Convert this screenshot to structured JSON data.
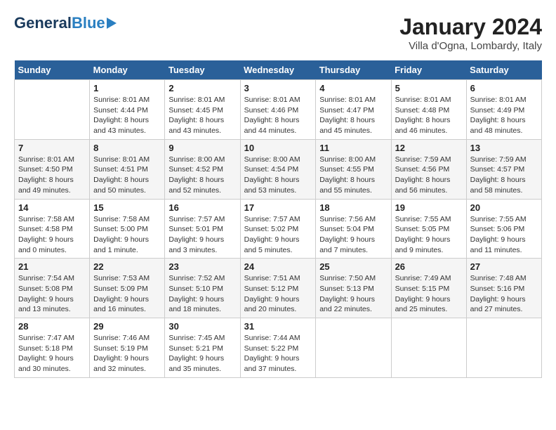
{
  "logo": {
    "general": "General",
    "blue": "Blue"
  },
  "title": "January 2024",
  "subtitle": "Villa d'Ogna, Lombardy, Italy",
  "weekdays": [
    "Sunday",
    "Monday",
    "Tuesday",
    "Wednesday",
    "Thursday",
    "Friday",
    "Saturday"
  ],
  "weeks": [
    [
      {
        "day": "",
        "sunrise": "",
        "sunset": "",
        "daylight": ""
      },
      {
        "day": "1",
        "sunrise": "Sunrise: 8:01 AM",
        "sunset": "Sunset: 4:44 PM",
        "daylight": "Daylight: 8 hours and 43 minutes."
      },
      {
        "day": "2",
        "sunrise": "Sunrise: 8:01 AM",
        "sunset": "Sunset: 4:45 PM",
        "daylight": "Daylight: 8 hours and 43 minutes."
      },
      {
        "day": "3",
        "sunrise": "Sunrise: 8:01 AM",
        "sunset": "Sunset: 4:46 PM",
        "daylight": "Daylight: 8 hours and 44 minutes."
      },
      {
        "day": "4",
        "sunrise": "Sunrise: 8:01 AM",
        "sunset": "Sunset: 4:47 PM",
        "daylight": "Daylight: 8 hours and 45 minutes."
      },
      {
        "day": "5",
        "sunrise": "Sunrise: 8:01 AM",
        "sunset": "Sunset: 4:48 PM",
        "daylight": "Daylight: 8 hours and 46 minutes."
      },
      {
        "day": "6",
        "sunrise": "Sunrise: 8:01 AM",
        "sunset": "Sunset: 4:49 PM",
        "daylight": "Daylight: 8 hours and 48 minutes."
      }
    ],
    [
      {
        "day": "7",
        "sunrise": "Sunrise: 8:01 AM",
        "sunset": "Sunset: 4:50 PM",
        "daylight": "Daylight: 8 hours and 49 minutes."
      },
      {
        "day": "8",
        "sunrise": "Sunrise: 8:01 AM",
        "sunset": "Sunset: 4:51 PM",
        "daylight": "Daylight: 8 hours and 50 minutes."
      },
      {
        "day": "9",
        "sunrise": "Sunrise: 8:00 AM",
        "sunset": "Sunset: 4:52 PM",
        "daylight": "Daylight: 8 hours and 52 minutes."
      },
      {
        "day": "10",
        "sunrise": "Sunrise: 8:00 AM",
        "sunset": "Sunset: 4:54 PM",
        "daylight": "Daylight: 8 hours and 53 minutes."
      },
      {
        "day": "11",
        "sunrise": "Sunrise: 8:00 AM",
        "sunset": "Sunset: 4:55 PM",
        "daylight": "Daylight: 8 hours and 55 minutes."
      },
      {
        "day": "12",
        "sunrise": "Sunrise: 7:59 AM",
        "sunset": "Sunset: 4:56 PM",
        "daylight": "Daylight: 8 hours and 56 minutes."
      },
      {
        "day": "13",
        "sunrise": "Sunrise: 7:59 AM",
        "sunset": "Sunset: 4:57 PM",
        "daylight": "Daylight: 8 hours and 58 minutes."
      }
    ],
    [
      {
        "day": "14",
        "sunrise": "Sunrise: 7:58 AM",
        "sunset": "Sunset: 4:58 PM",
        "daylight": "Daylight: 9 hours and 0 minutes."
      },
      {
        "day": "15",
        "sunrise": "Sunrise: 7:58 AM",
        "sunset": "Sunset: 5:00 PM",
        "daylight": "Daylight: 9 hours and 1 minute."
      },
      {
        "day": "16",
        "sunrise": "Sunrise: 7:57 AM",
        "sunset": "Sunset: 5:01 PM",
        "daylight": "Daylight: 9 hours and 3 minutes."
      },
      {
        "day": "17",
        "sunrise": "Sunrise: 7:57 AM",
        "sunset": "Sunset: 5:02 PM",
        "daylight": "Daylight: 9 hours and 5 minutes."
      },
      {
        "day": "18",
        "sunrise": "Sunrise: 7:56 AM",
        "sunset": "Sunset: 5:04 PM",
        "daylight": "Daylight: 9 hours and 7 minutes."
      },
      {
        "day": "19",
        "sunrise": "Sunrise: 7:55 AM",
        "sunset": "Sunset: 5:05 PM",
        "daylight": "Daylight: 9 hours and 9 minutes."
      },
      {
        "day": "20",
        "sunrise": "Sunrise: 7:55 AM",
        "sunset": "Sunset: 5:06 PM",
        "daylight": "Daylight: 9 hours and 11 minutes."
      }
    ],
    [
      {
        "day": "21",
        "sunrise": "Sunrise: 7:54 AM",
        "sunset": "Sunset: 5:08 PM",
        "daylight": "Daylight: 9 hours and 13 minutes."
      },
      {
        "day": "22",
        "sunrise": "Sunrise: 7:53 AM",
        "sunset": "Sunset: 5:09 PM",
        "daylight": "Daylight: 9 hours and 16 minutes."
      },
      {
        "day": "23",
        "sunrise": "Sunrise: 7:52 AM",
        "sunset": "Sunset: 5:10 PM",
        "daylight": "Daylight: 9 hours and 18 minutes."
      },
      {
        "day": "24",
        "sunrise": "Sunrise: 7:51 AM",
        "sunset": "Sunset: 5:12 PM",
        "daylight": "Daylight: 9 hours and 20 minutes."
      },
      {
        "day": "25",
        "sunrise": "Sunrise: 7:50 AM",
        "sunset": "Sunset: 5:13 PM",
        "daylight": "Daylight: 9 hours and 22 minutes."
      },
      {
        "day": "26",
        "sunrise": "Sunrise: 7:49 AM",
        "sunset": "Sunset: 5:15 PM",
        "daylight": "Daylight: 9 hours and 25 minutes."
      },
      {
        "day": "27",
        "sunrise": "Sunrise: 7:48 AM",
        "sunset": "Sunset: 5:16 PM",
        "daylight": "Daylight: 9 hours and 27 minutes."
      }
    ],
    [
      {
        "day": "28",
        "sunrise": "Sunrise: 7:47 AM",
        "sunset": "Sunset: 5:18 PM",
        "daylight": "Daylight: 9 hours and 30 minutes."
      },
      {
        "day": "29",
        "sunrise": "Sunrise: 7:46 AM",
        "sunset": "Sunset: 5:19 PM",
        "daylight": "Daylight: 9 hours and 32 minutes."
      },
      {
        "day": "30",
        "sunrise": "Sunrise: 7:45 AM",
        "sunset": "Sunset: 5:21 PM",
        "daylight": "Daylight: 9 hours and 35 minutes."
      },
      {
        "day": "31",
        "sunrise": "Sunrise: 7:44 AM",
        "sunset": "Sunset: 5:22 PM",
        "daylight": "Daylight: 9 hours and 37 minutes."
      },
      {
        "day": "",
        "sunrise": "",
        "sunset": "",
        "daylight": ""
      },
      {
        "day": "",
        "sunrise": "",
        "sunset": "",
        "daylight": ""
      },
      {
        "day": "",
        "sunrise": "",
        "sunset": "",
        "daylight": ""
      }
    ]
  ]
}
